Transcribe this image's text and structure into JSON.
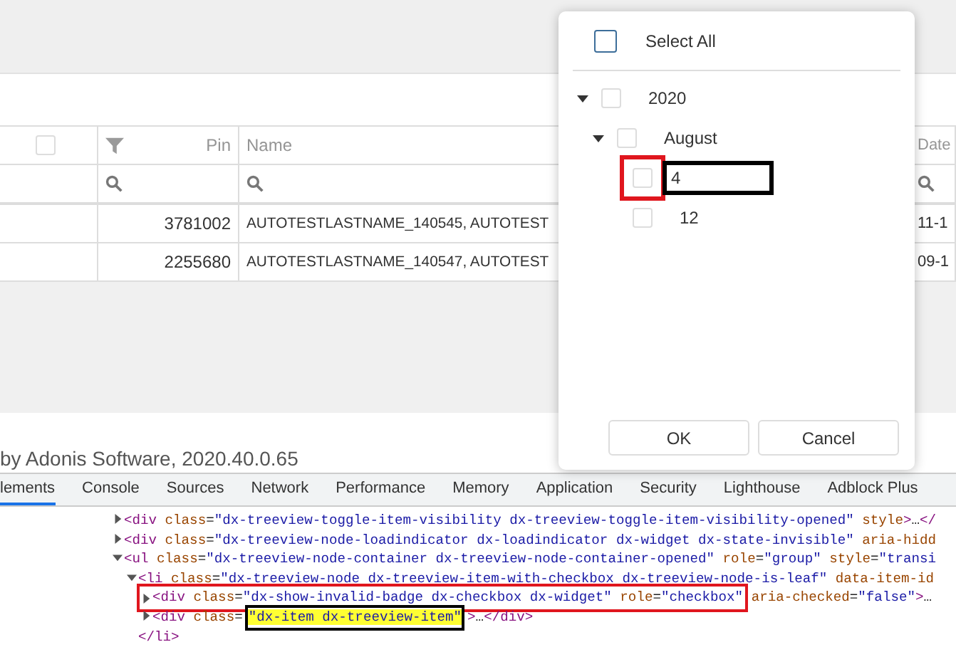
{
  "grid": {
    "columns": [
      {
        "kind": "select",
        "checked": false
      },
      {
        "kind": "number",
        "label": "Pin"
      },
      {
        "kind": "text",
        "label": "Name"
      },
      {
        "kind": "text",
        "label": "Date"
      }
    ],
    "rows": [
      {
        "pin": "3781002",
        "name": "AUTOTESTLASTNAME_140545, AUTOTEST",
        "date": "11-1"
      },
      {
        "pin": "2255680",
        "name": "AUTOTESTLASTNAME_140547, AUTOTEST",
        "date": "09-1"
      }
    ]
  },
  "footer": {
    "text": "by Adonis Software, 2020.40.0.65"
  },
  "filter_popup": {
    "select_all": {
      "label": "Select All",
      "checked": false
    },
    "tree": [
      {
        "label": "2020",
        "checked": false,
        "expanded": true,
        "children": [
          {
            "label": "August",
            "checked": false,
            "expanded": true,
            "children": [
              {
                "label": "4",
                "checked": false,
                "checkbox_frame": {
                  "color": "#e0161e"
                },
                "label_frame": {
                  "color": "#000000"
                }
              },
              {
                "label": "12",
                "checked": false
              }
            ]
          }
        ]
      }
    ],
    "buttons": [
      "OK",
      "Cancel"
    ]
  },
  "devtools": {
    "tabs": [
      {
        "label": "lements",
        "selected": true
      },
      {
        "label": "Console",
        "selected": false
      },
      {
        "label": "Sources",
        "selected": false
      },
      {
        "label": "Network",
        "selected": false
      },
      {
        "label": "Performance",
        "selected": false
      },
      {
        "label": "Memory",
        "selected": false
      },
      {
        "label": "Application",
        "selected": false
      },
      {
        "label": "Security",
        "selected": false
      },
      {
        "label": "Lighthouse",
        "selected": false
      },
      {
        "label": "Adblock Plus",
        "selected": false
      }
    ],
    "nodes": [
      {
        "expanded": false,
        "tokens": [
          {
            "kind": "tag",
            "text": "<div"
          },
          {
            "kind": "attr",
            "text": " class"
          },
          {
            "kind": "plain",
            "text": "="
          },
          {
            "kind": "value",
            "text": "\"dx-treeview-toggle-item-visibility dx-treeview-toggle-item-visibility-opened\""
          },
          {
            "kind": "attr",
            "text": " style"
          },
          {
            "kind": "tag",
            "text": ">"
          },
          {
            "kind": "plain",
            "text": "…"
          },
          {
            "kind": "tag",
            "text": "</"
          }
        ]
      },
      {
        "expanded": false,
        "tokens": [
          {
            "kind": "tag",
            "text": "<div"
          },
          {
            "kind": "attr",
            "text": " class"
          },
          {
            "kind": "plain",
            "text": "="
          },
          {
            "kind": "value",
            "text": "\"dx-treeview-node-loadindicator dx-loadindicator dx-widget dx-state-invisible\""
          },
          {
            "kind": "attr",
            "text": " aria-hidd"
          }
        ]
      },
      {
        "expanded": true,
        "tokens": [
          {
            "kind": "tag",
            "text": "<ul"
          },
          {
            "kind": "attr",
            "text": " class"
          },
          {
            "kind": "plain",
            "text": "="
          },
          {
            "kind": "value",
            "text": "\"dx-treeview-node-container dx-treeview-node-container-opened\""
          },
          {
            "kind": "attr",
            "text": " role"
          },
          {
            "kind": "plain",
            "text": "="
          },
          {
            "kind": "value",
            "text": "\"group\""
          },
          {
            "kind": "attr",
            "text": " style"
          },
          {
            "kind": "plain",
            "text": "="
          },
          {
            "kind": "value",
            "text": "\"transi"
          }
        ],
        "children": [
          {
            "expanded": true,
            "tokens": [
              {
                "kind": "tag",
                "text": "<li"
              },
              {
                "kind": "attr",
                "text": " class"
              },
              {
                "kind": "plain",
                "text": "="
              },
              {
                "kind": "value",
                "text": "\"dx-treeview-node dx-treeview-item-with-checkbox dx-treeview-node-is-leaf\""
              },
              {
                "kind": "attr",
                "text": " data-item-id"
              }
            ],
            "closing": [
              {
                "kind": "tag",
                "text": "</li>"
              }
            ],
            "children": [
              {
                "expanded": false,
                "frame": {
                  "color": "#e0161e"
                },
                "framed_tokens": [
                  {
                    "kind": "tag",
                    "text": "<div"
                  },
                  {
                    "kind": "attr",
                    "text": " class"
                  },
                  {
                    "kind": "plain",
                    "text": "="
                  },
                  {
                    "kind": "value",
                    "text": "\"dx-show-invalid-badge dx-checkbox dx-widget\""
                  },
                  {
                    "kind": "attr",
                    "text": " role"
                  },
                  {
                    "kind": "plain",
                    "text": "="
                  },
                  {
                    "kind": "value",
                    "text": "\"checkbox\""
                  }
                ],
                "tokens": [
                  {
                    "kind": "attr",
                    "text": " aria-checked"
                  },
                  {
                    "kind": "plain",
                    "text": "="
                  },
                  {
                    "kind": "value",
                    "text": "\"false\""
                  },
                  {
                    "kind": "tag",
                    "text": ">"
                  },
                  {
                    "kind": "plain",
                    "text": "…"
                  }
                ]
              },
              {
                "expanded": false,
                "tokens": [
                  {
                    "kind": "tag",
                    "text": "<div"
                  },
                  {
                    "kind": "attr",
                    "text": " class"
                  },
                  {
                    "kind": "plain",
                    "text": "="
                  },
                  {
                    "kind": "value",
                    "text": "\"dx-item dx-treeview-item\"",
                    "highlighted": true,
                    "frame": {
                      "color": "#000000"
                    }
                  },
                  {
                    "kind": "tag",
                    "text": ">"
                  },
                  {
                    "kind": "plain",
                    "text": "…"
                  },
                  {
                    "kind": "tag",
                    "text": "</div>"
                  }
                ]
              }
            ]
          }
        ]
      }
    ]
  }
}
